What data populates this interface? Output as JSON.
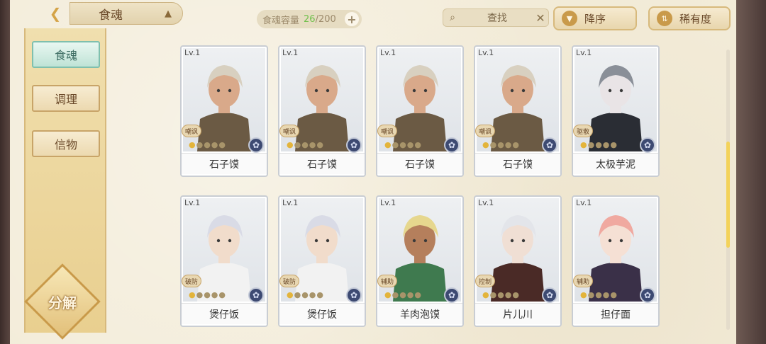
{
  "header": {
    "title": "食魂",
    "capacity_label": "食魂容量",
    "capacity_current": "26",
    "capacity_total": "/200",
    "search_label": "查找",
    "sort_order_label": "降序",
    "sort_rarity_label": "稀有度"
  },
  "sidebar": {
    "tabs": [
      {
        "label": "食魂",
        "active": true
      },
      {
        "label": "调理",
        "active": false
      },
      {
        "label": "信物",
        "active": false
      }
    ],
    "decompose_label": "分解"
  },
  "cards": [
    {
      "level": "Lv.1",
      "name": "石子馍",
      "role": "嘲讽",
      "hair": "#d8d0c0",
      "outfit": "#6b5a44",
      "skin": "#d9a98a"
    },
    {
      "level": "Lv.1",
      "name": "石子馍",
      "role": "嘲讽",
      "hair": "#d8d0c0",
      "outfit": "#6b5a44",
      "skin": "#d9a98a"
    },
    {
      "level": "Lv.1",
      "name": "石子馍",
      "role": "嘲讽",
      "hair": "#d8d0c0",
      "outfit": "#6b5a44",
      "skin": "#d9a98a"
    },
    {
      "level": "Lv.1",
      "name": "石子馍",
      "role": "嘲讽",
      "hair": "#d8d0c0",
      "outfit": "#6b5a44",
      "skin": "#d9a98a"
    },
    {
      "level": "Lv.1",
      "name": "太极芋泥",
      "role": "驱散",
      "hair": "#8a8f98",
      "outfit": "#2a2d34",
      "skin": "#e9e4e6"
    },
    {
      "level": "Lv.1",
      "name": "煲仔饭",
      "role": "破防",
      "hair": "#d9dbe6",
      "outfit": "#f2f2f2",
      "skin": "#f1dccb"
    },
    {
      "level": "Lv.1",
      "name": "煲仔饭",
      "role": "破防",
      "hair": "#d9dbe6",
      "outfit": "#f2f2f2",
      "skin": "#f1dccb"
    },
    {
      "level": "Lv.1",
      "name": "羊肉泡馍",
      "role": "辅助",
      "hair": "#e6d78e",
      "outfit": "#3f7a4f",
      "skin": "#b57f5c"
    },
    {
      "level": "Lv.1",
      "name": "片儿川",
      "role": "控制",
      "hair": "#e3e5ea",
      "outfit": "#4a2a26",
      "skin": "#f0dfd4"
    },
    {
      "level": "Lv.1",
      "name": "担仔面",
      "role": "辅助",
      "hair": "#f0a9a0",
      "outfit": "#3a3048",
      "skin": "#f5e0d4"
    }
  ],
  "colors": {
    "background": "#f3ecd9",
    "accent_gold": "#c99a4a",
    "active_tab": "#bfe3d6",
    "capacity_current": "#6fbf4a"
  }
}
